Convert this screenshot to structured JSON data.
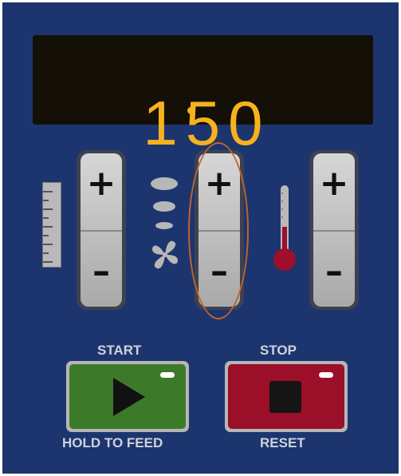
{
  "display": {
    "value": "150",
    "color": "#f6b21d"
  },
  "rockers": [
    {
      "name": "length",
      "plus": "+",
      "minus": "–"
    },
    {
      "name": "speed",
      "plus": "+",
      "minus": "–"
    },
    {
      "name": "temperature",
      "plus": "+",
      "minus": "–"
    }
  ],
  "icons": {
    "left": "ruler-icon",
    "middle": "fan-speed-icon",
    "right": "thermometer-icon"
  },
  "buttons": {
    "start": {
      "top_label": "START",
      "bottom_label": "HOLD TO FEED",
      "icon": "play-icon",
      "color": "#3c7a2a"
    },
    "stop": {
      "top_label": "STOP",
      "bottom_label": "RESET",
      "icon": "stop-square-icon",
      "color": "#9b0f29"
    }
  },
  "colors": {
    "panel": "#1c356e",
    "display_bg": "#141007",
    "highlight": "#c0642a"
  }
}
